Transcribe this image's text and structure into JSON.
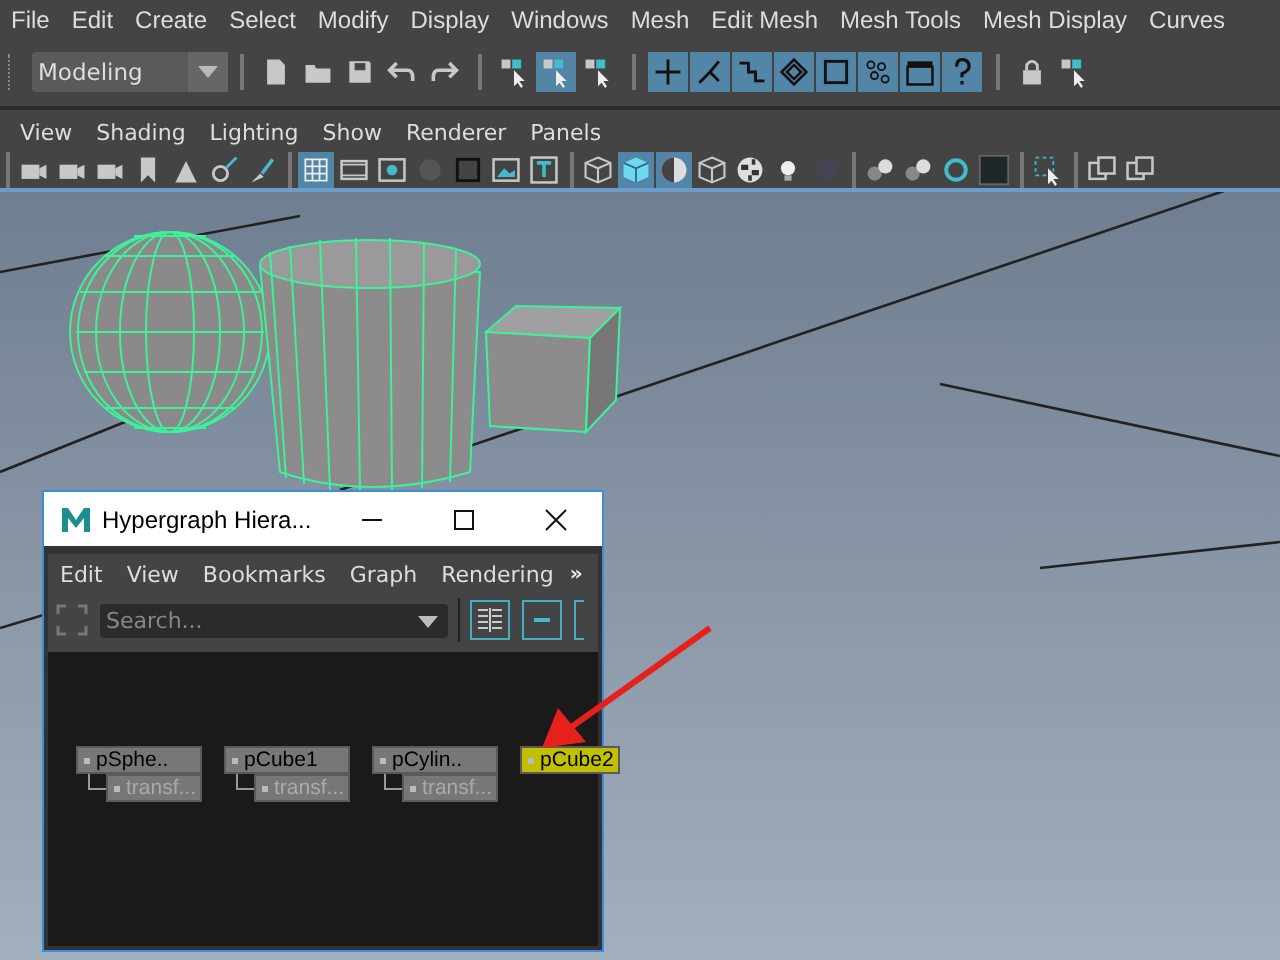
{
  "menu_bar": [
    "File",
    "Edit",
    "Create",
    "Select",
    "Modify",
    "Display",
    "Windows",
    "Mesh",
    "Edit Mesh",
    "Mesh Tools",
    "Mesh Display",
    "Curves"
  ],
  "status_line": {
    "workspace": "Modeling",
    "tools": [
      {
        "on": false
      },
      {
        "on": false
      },
      {
        "on": false
      },
      {
        "on": false
      },
      {
        "on": false
      },
      {
        "on": false
      },
      {
        "on": true
      },
      {
        "on": false
      },
      {
        "on": true
      },
      {
        "on": true
      },
      {
        "on": true
      },
      {
        "on": true
      },
      {
        "on": true
      },
      {
        "on": true
      },
      {
        "on": true
      },
      {
        "on": true
      },
      {
        "on": false
      },
      {
        "on": false
      }
    ]
  },
  "panel_menu": [
    "View",
    "Shading",
    "Lighting",
    "Show",
    "Renderer",
    "Panels"
  ],
  "panel_tools": [
    {
      "on": false
    },
    {
      "on": false
    },
    {
      "on": false
    },
    {
      "on": false
    },
    {
      "on": false
    },
    {
      "on": false
    },
    {
      "on": false
    },
    {
      "on": true
    },
    {
      "on": false
    },
    {
      "on": false
    },
    {
      "on": false
    },
    {
      "on": false
    },
    {
      "on": false
    },
    {
      "on": false
    },
    {
      "on": false
    },
    {
      "on": true
    },
    {
      "on": true
    },
    {
      "on": false
    },
    {
      "on": false
    },
    {
      "on": false
    },
    {
      "on": false
    },
    {
      "on": false
    },
    {
      "on": false
    },
    {
      "on": false
    },
    {
      "on": false
    },
    {
      "on": false
    },
    {
      "on": false
    },
    {
      "on": false
    }
  ],
  "hypergraph": {
    "title": "Hypergraph Hiera...",
    "menu": [
      "Edit",
      "View",
      "Bookmarks",
      "Graph",
      "Rendering"
    ],
    "more": "»",
    "search": {
      "placeholder": "Search..."
    },
    "nodes": [
      {
        "name": "pSphe..",
        "selected": false,
        "child": "transf..."
      },
      {
        "name": "pCube1",
        "selected": false,
        "child": "transf..."
      },
      {
        "name": "pCylin..",
        "selected": false,
        "child": "transf..."
      },
      {
        "name": "pCube2",
        "selected": true
      }
    ]
  }
}
